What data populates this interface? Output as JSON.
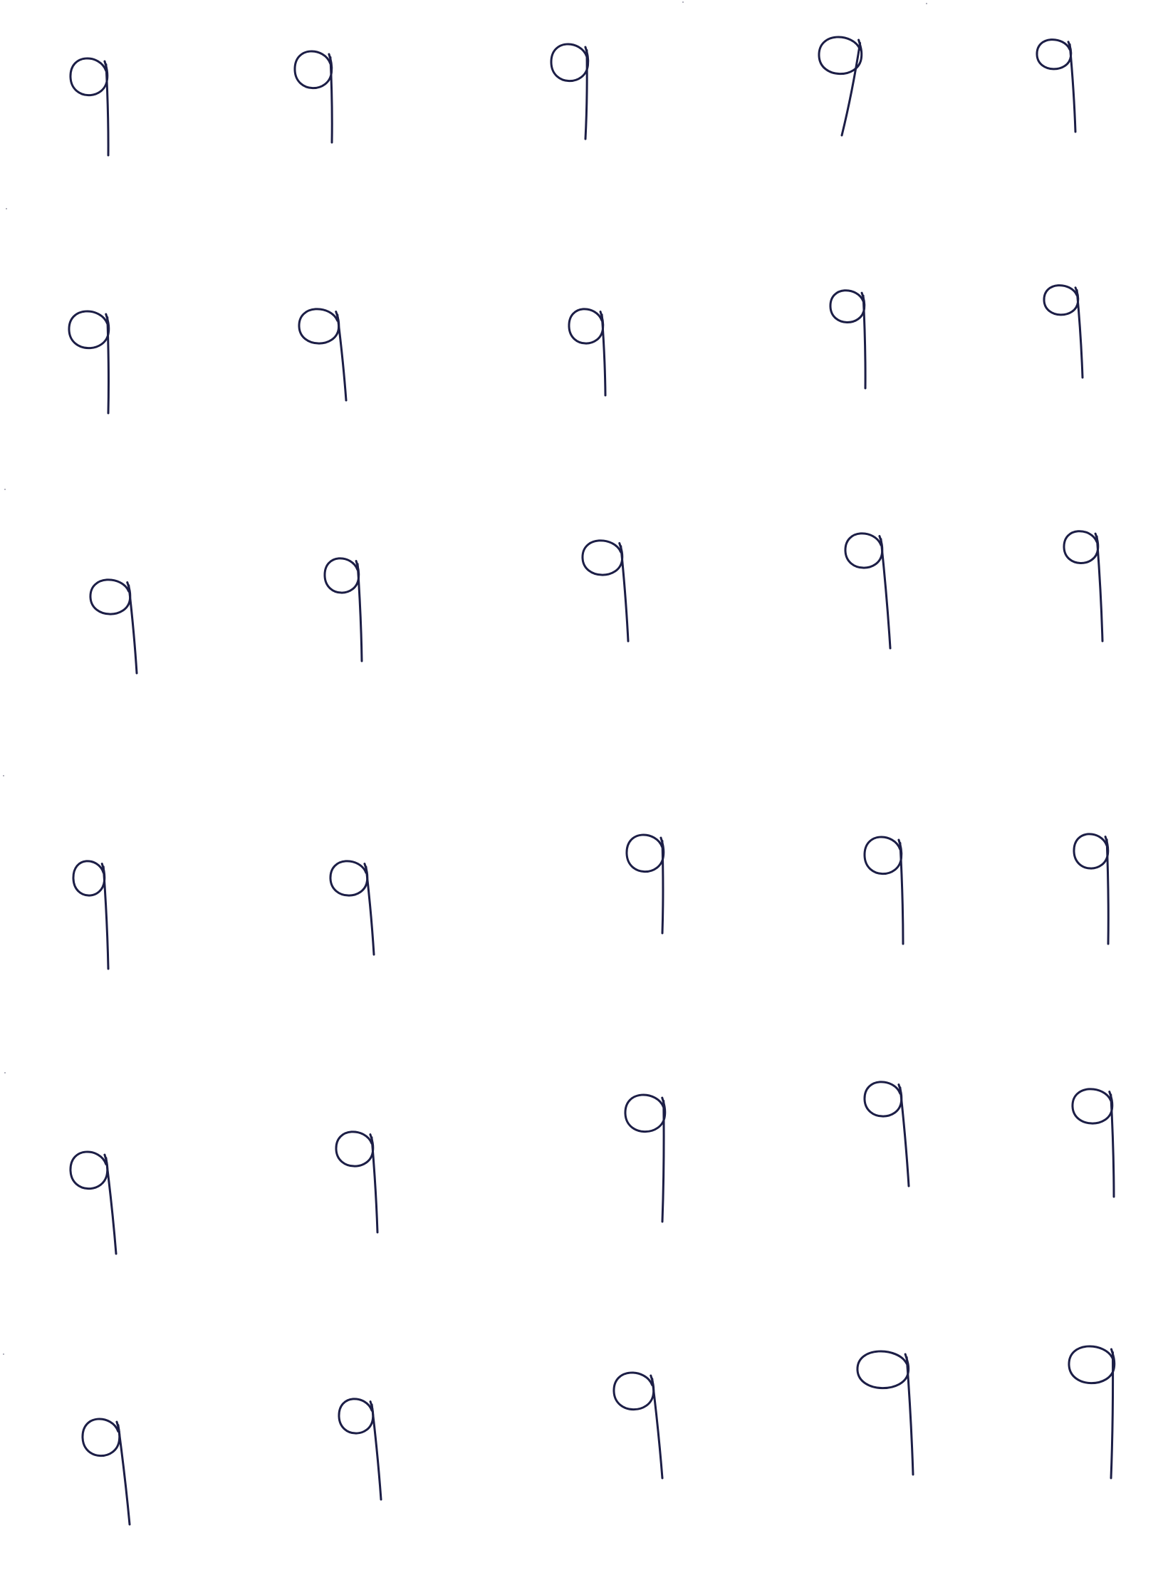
{
  "sheet": {
    "background": "#ffffff",
    "ink_color": "#1c1e46",
    "glyph": "9",
    "rows": 6,
    "columns": 5,
    "specimens": [
      [
        "9",
        "9",
        "9",
        "9",
        "9"
      ],
      [
        "9",
        "9",
        "9",
        "9",
        "9"
      ],
      [
        "9",
        "9",
        "9",
        "9",
        "9"
      ],
      [
        "9",
        "9",
        "9",
        "9",
        "9"
      ],
      [
        "9",
        "9",
        "9",
        "9",
        "9"
      ],
      [
        "9",
        "9",
        "9",
        "9",
        "9"
      ]
    ]
  }
}
